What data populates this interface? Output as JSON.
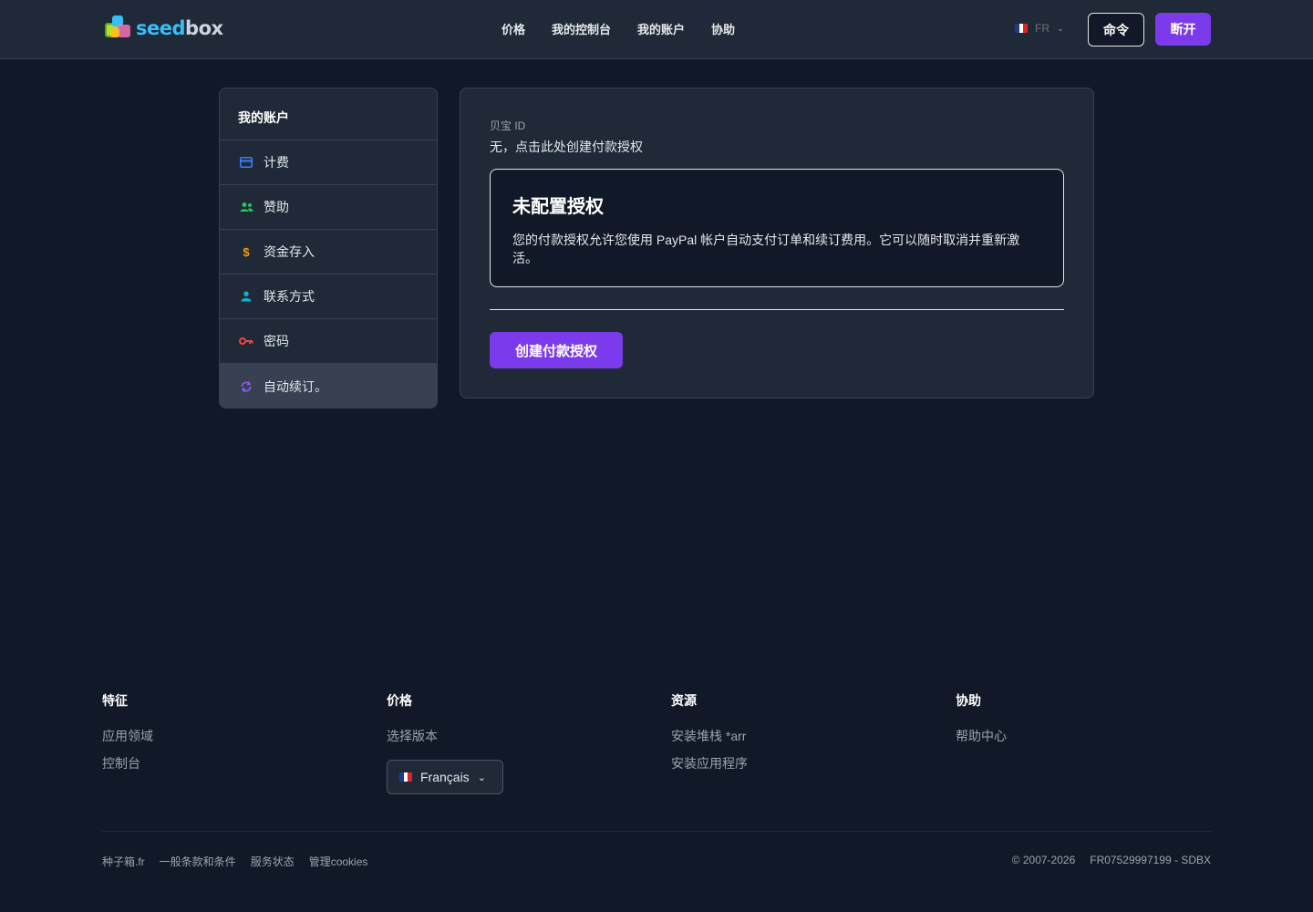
{
  "header": {
    "logo_text_a": "seed",
    "logo_text_b": "box",
    "nav": [
      "价格",
      "我的控制台",
      "我的账户",
      "协助"
    ],
    "lang_code": "FR",
    "btn_command": "命令",
    "btn_disconnect": "断开"
  },
  "sidebar": {
    "title": "我的账户",
    "items": [
      {
        "label": "计费",
        "icon": "credit-card-icon",
        "color": "#3b82f6"
      },
      {
        "label": "赞助",
        "icon": "users-icon",
        "color": "#22c55e"
      },
      {
        "label": "资金存入",
        "icon": "dollar-icon",
        "color": "#f59e0b"
      },
      {
        "label": "联系方式",
        "icon": "user-icon",
        "color": "#06b6d4"
      },
      {
        "label": "密码",
        "icon": "key-icon",
        "color": "#ef4444"
      },
      {
        "label": "自动续订。",
        "icon": "refresh-icon",
        "color": "#8b5cf6",
        "active": true
      }
    ]
  },
  "main": {
    "paypal_label": "贝宝 ID",
    "paypal_value": "无，点击此处创建付款授权",
    "notice_title": "未配置授权",
    "notice_text": "您的付款授权允许您使用 PayPal 帐户自动支付订单和续订费用。它可以随时取消并重新激活。",
    "create_button": "创建付款授权"
  },
  "footer": {
    "columns": [
      {
        "title": "特征",
        "links": [
          "应用领域",
          "控制台"
        ]
      },
      {
        "title": "价格",
        "links": [
          "选择版本"
        ]
      },
      {
        "title": "资源",
        "links": [
          "安装堆栈 *arr",
          "安装应用程序"
        ]
      },
      {
        "title": "协助",
        "links": [
          "帮助中心"
        ]
      }
    ],
    "language": "Français",
    "bottom_links": [
      "种子箱.fr",
      "一般条款和条件",
      "服务状态",
      "管理cookies"
    ],
    "copyright": "© 2007-2026",
    "company_id": "FR07529997199 - SDBX"
  },
  "colors": {
    "background": "#111827",
    "surface": "#1f2937",
    "accent": "#7c3aed",
    "flag_fr": [
      "#1e3a8a",
      "#ffffff",
      "#dc2626"
    ]
  }
}
